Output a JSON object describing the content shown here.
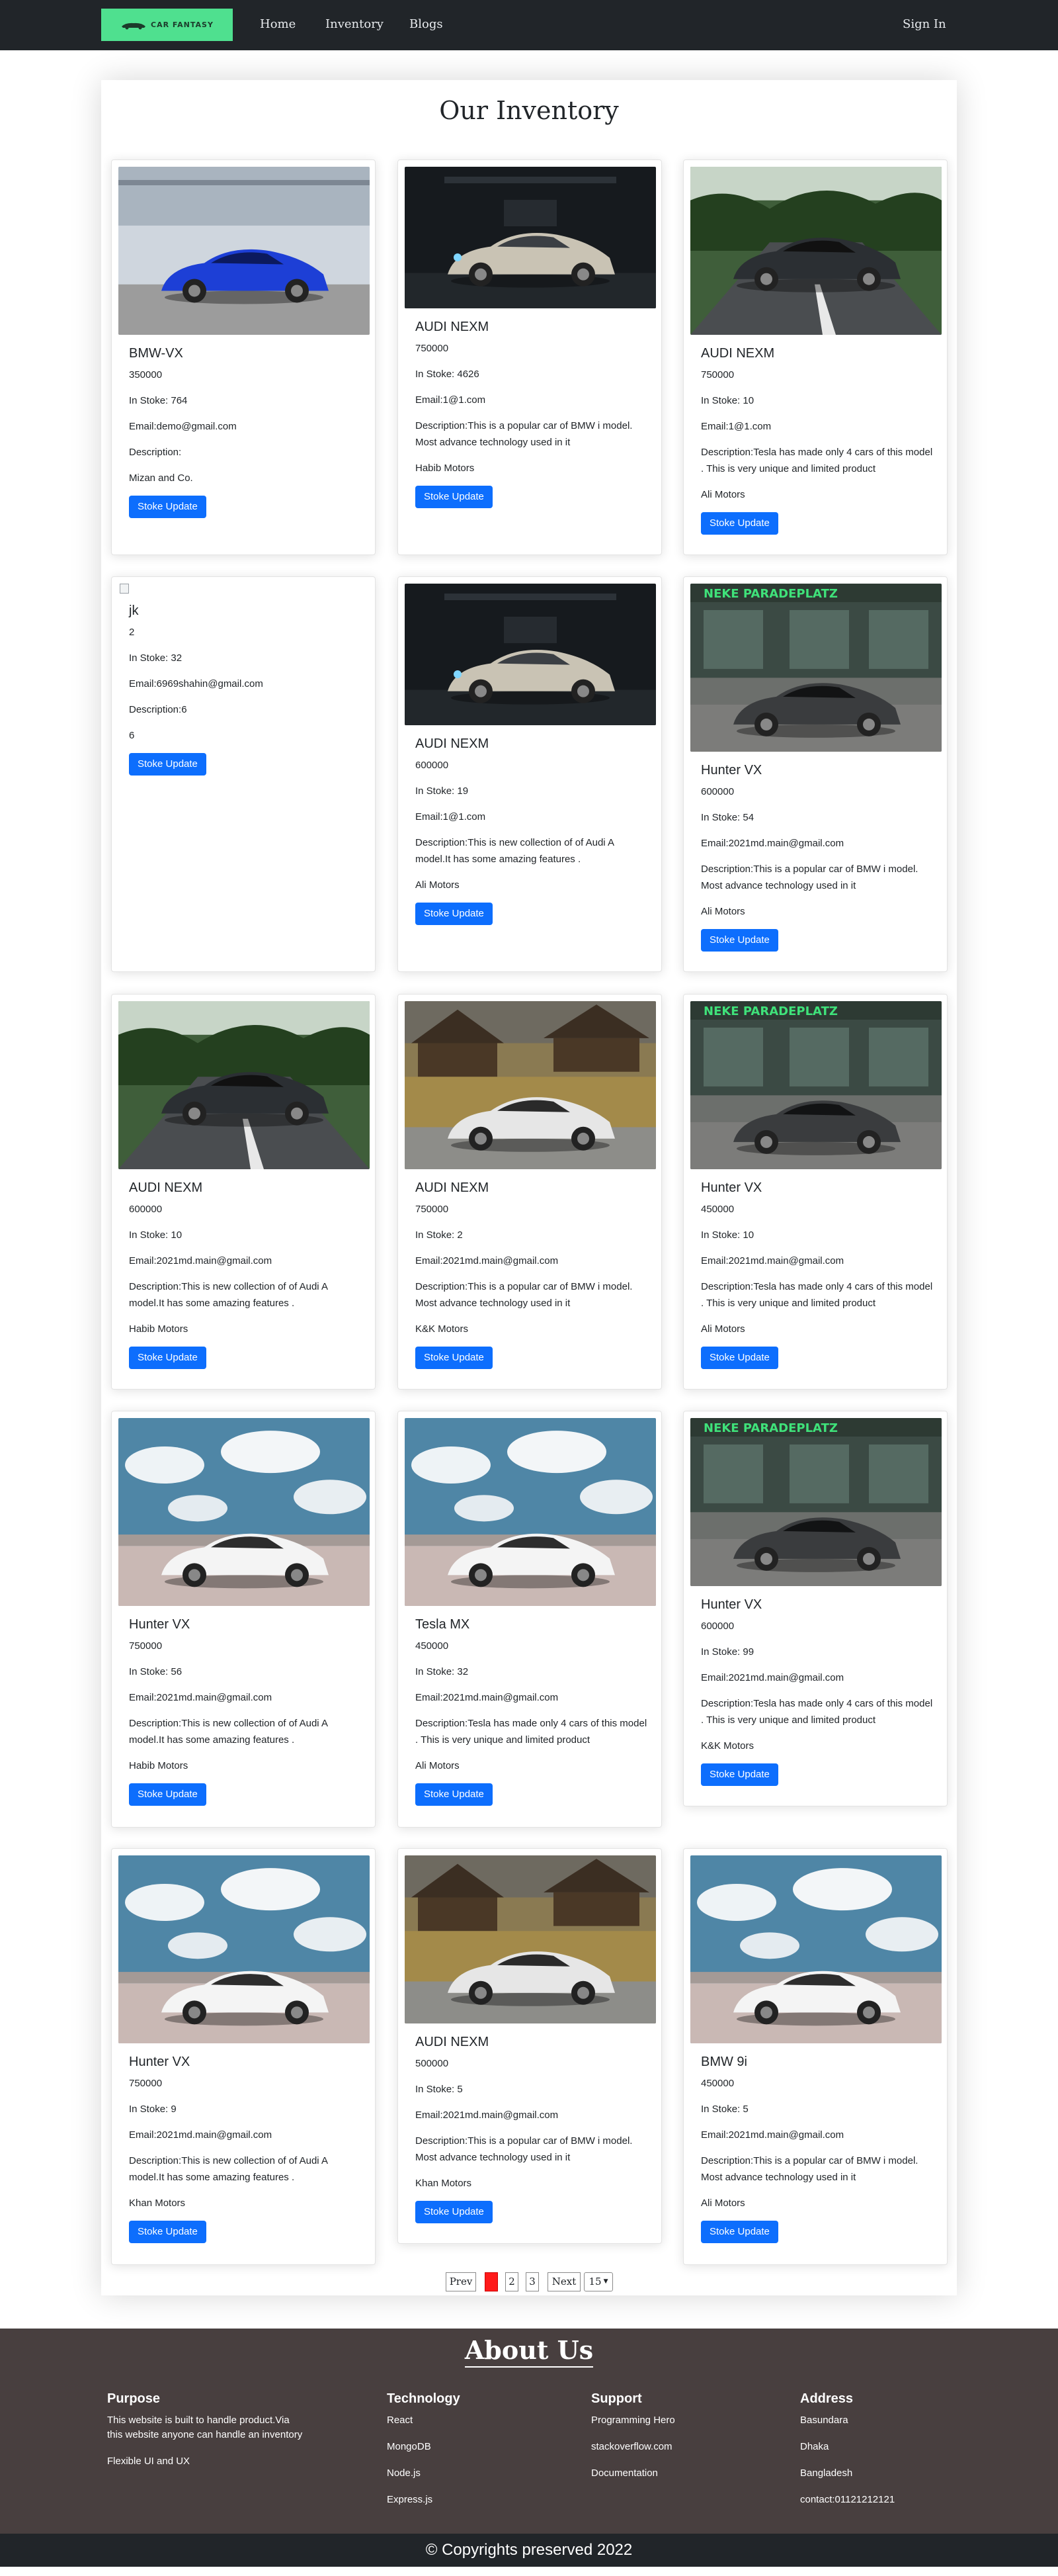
{
  "nav": {
    "logo_text": "CAR FANTASY",
    "links": [
      "Home",
      "Inventory",
      "Blogs"
    ],
    "signin": "Sign In"
  },
  "page_title": "Our Inventory",
  "products": [
    {
      "name": "BMW-VX",
      "price": "350000",
      "stock": "In Stoke: 764",
      "email": "Email:demo@gmail.com",
      "desc": "Description:",
      "supplier": "Mizan and Co.",
      "button": "Stoke Update",
      "image": "blue-bmw"
    },
    {
      "name": "AUDI NEXM",
      "price": "750000",
      "stock": "In Stoke: 4626",
      "email": "Email:1@1.com",
      "desc": "Description:This is a popular car of BMW i model. Most advance technology used in it",
      "supplier": "Habib Motors",
      "button": "Stoke Update",
      "image": "white-audi-garage"
    },
    {
      "name": "AUDI NEXM",
      "price": "750000",
      "stock": "In Stoke: 10",
      "email": "Email:1@1.com",
      "desc": "Description:Tesla has made only 4 cars of this model . This is very unique and limited product",
      "supplier": "Ali Motors",
      "button": "Stoke Update",
      "image": "dark-audi-road"
    },
    {
      "name": "jk",
      "price": "2",
      "stock": "In Stoke: 32",
      "email": "Email:6969shahin@gmail.com",
      "desc": "Description:6",
      "supplier": "6",
      "button": "Stoke Update",
      "image": "broken-image"
    },
    {
      "name": "AUDI NEXM",
      "price": "600000",
      "stock": "In Stoke: 19",
      "email": "Email:1@1.com",
      "desc": "Description:This is new collection of of Audi A model.It has some amazing features .",
      "supplier": "Ali Motors",
      "button": "Stoke Update",
      "image": "white-audi-garage"
    },
    {
      "name": "Hunter VX",
      "price": "600000",
      "stock": "In Stoke: 54",
      "email": "Email:2021md.main@gmail.com",
      "desc": "Description:This is a popular car of BMW i model. Most advance technology used in it",
      "supplier": "Ali Motors",
      "button": "Stoke Update",
      "image": "mclaren-paradeplatz"
    },
    {
      "name": "AUDI NEXM",
      "price": "600000",
      "stock": "In Stoke: 10",
      "email": "Email:2021md.main@gmail.com",
      "desc": "Description:This is new collection of of Audi A model.It has some amazing features .",
      "supplier": "Habib Motors",
      "button": "Stoke Update",
      "image": "dark-audi-road"
    },
    {
      "name": "AUDI NEXM",
      "price": "750000",
      "stock": "In Stoke: 2",
      "email": "Email:2021md.main@gmail.com",
      "desc": "Description:This is a popular car of BMW i model. Most advance technology used in it",
      "supplier": "K&K Motors",
      "button": "Stoke Update",
      "image": "white-mclaren-cabins"
    },
    {
      "name": "Hunter VX",
      "price": "450000",
      "stock": "In Stoke: 10",
      "email": "Email:2021md.main@gmail.com",
      "desc": "Description:Tesla has made only 4 cars of this model . This is very unique and limited product",
      "supplier": "Ali Motors",
      "button": "Stoke Update",
      "image": "mclaren-paradeplatz"
    },
    {
      "name": "Hunter VX",
      "price": "750000",
      "stock": "In Stoke: 56",
      "email": "Email:2021md.main@gmail.com",
      "desc": "Description:This is new collection of of Audi A model.It has some amazing features .",
      "supplier": "Habib Motors",
      "button": "Stoke Update",
      "image": "white-bmw-sky"
    },
    {
      "name": "Tesla MX",
      "price": "450000",
      "stock": "In Stoke: 32",
      "email": "Email:2021md.main@gmail.com",
      "desc": "Description:Tesla has made only 4 cars of this model . This is very unique and limited product",
      "supplier": "Ali Motors",
      "button": "Stoke Update",
      "image": "white-bmw-sky"
    },
    {
      "name": "Hunter VX",
      "price": "600000",
      "stock": "In Stoke: 99",
      "email": "Email:2021md.main@gmail.com",
      "desc": "Description:Tesla has made only 4 cars of this model . This is very unique and limited product",
      "supplier": "K&K Motors",
      "button": "Stoke Update",
      "image": "mclaren-paradeplatz"
    },
    {
      "name": "Hunter VX",
      "price": "750000",
      "stock": "In Stoke: 9",
      "email": "Email:2021md.main@gmail.com",
      "desc": "Description:This is new collection of of Audi A model.It has some amazing features .",
      "supplier": "Khan Motors",
      "button": "Stoke Update",
      "image": "white-bmw-sky"
    },
    {
      "name": "AUDI NEXM",
      "price": "500000",
      "stock": "In Stoke: 5",
      "email": "Email:2021md.main@gmail.com",
      "desc": "Description:This is a popular car of BMW i model. Most advance technology used in it",
      "supplier": "Khan Motors",
      "button": "Stoke Update",
      "image": "white-mclaren-cabins"
    },
    {
      "name": "BMW 9i",
      "price": "450000",
      "stock": "In Stoke: 5",
      "email": "Email:2021md.main@gmail.com",
      "desc": "Description:This is a popular car of BMW i model. Most advance technology used in it",
      "supplier": "Ali Motors",
      "button": "Stoke Update",
      "image": "white-bmw-sky"
    }
  ],
  "pagination": {
    "prev": "Prev",
    "pages": [
      "1",
      "2",
      "3"
    ],
    "next": "Next",
    "page_size": "15",
    "active_page": "1"
  },
  "footer": {
    "about_title": "About Us",
    "columns": [
      {
        "heading": "Purpose",
        "items": [
          "This website is built to handle product.Via this website anyone can handle an inventory",
          "Flexible UI and UX"
        ]
      },
      {
        "heading": "Technology",
        "items": [
          "React",
          "MongoDB",
          "Node.js",
          "Express.js"
        ]
      },
      {
        "heading": "Support",
        "items": [
          "Programming Hero",
          "stackoverflow.com",
          "Documentation"
        ]
      },
      {
        "heading": "Address",
        "items": [
          "Basundara",
          "Dhaka",
          "Bangladesh",
          "contact:01121212121"
        ]
      }
    ],
    "copyright": "© Copyrights preserved 2022"
  },
  "colors": {
    "navbar": "#212529",
    "logo_bg": "#4fe08f",
    "button": "#0d6efd",
    "active_page": "#ff1a1a",
    "footer_bg": "#483f3f"
  }
}
